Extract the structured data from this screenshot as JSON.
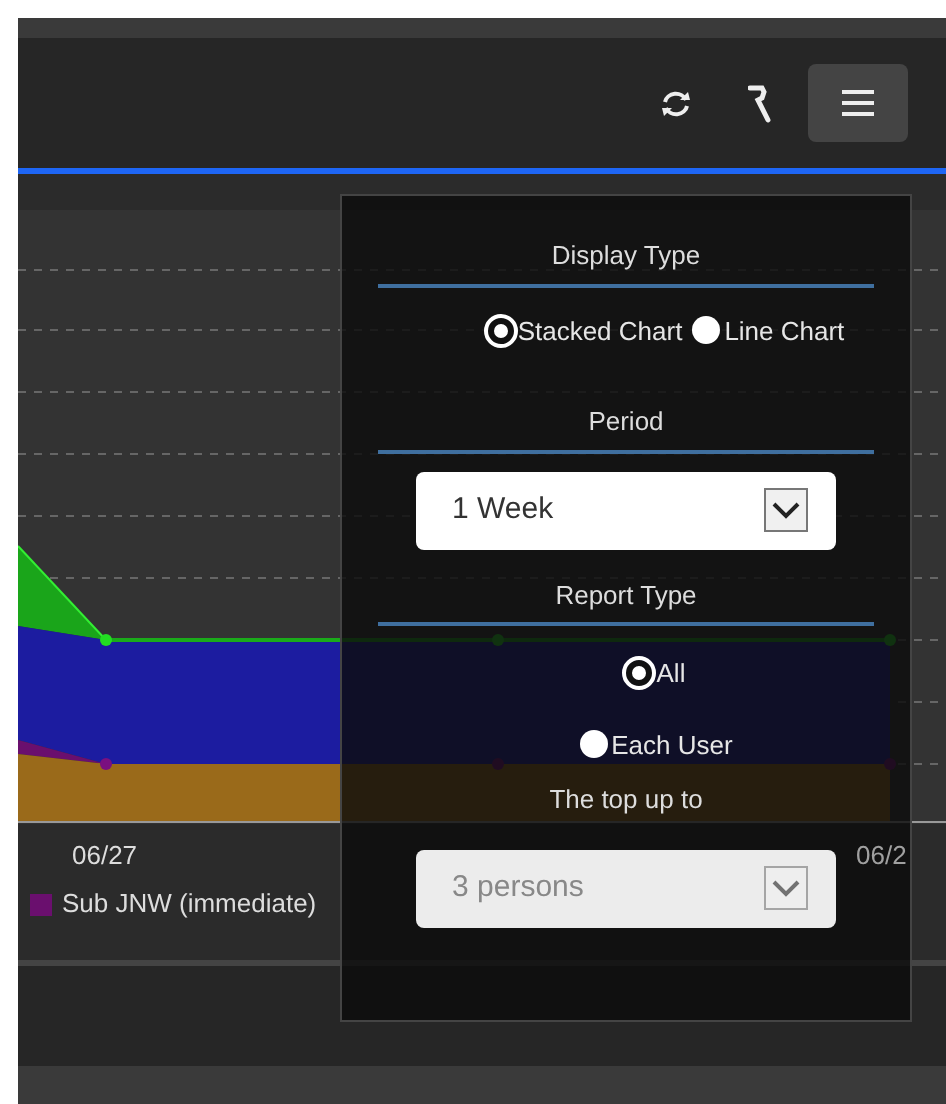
{
  "toolbar": {
    "menu_button": {
      "expanded": true
    }
  },
  "chart": {
    "x_labels": [
      "06/27",
      "06/2"
    ],
    "legend": [
      {
        "label": "Sub JNW (immediate)",
        "color": "#6a0f6e"
      }
    ]
  },
  "menu": {
    "sections": [
      {
        "kind": "radio_row",
        "title": "Display Type",
        "underlined": true,
        "options": [
          {
            "label": "Stacked Chart",
            "selected": true
          },
          {
            "label": "Line Chart",
            "selected": false
          }
        ]
      },
      {
        "kind": "select",
        "title": "Period",
        "underlined": true,
        "value": "1 Week",
        "disabled": false
      },
      {
        "kind": "radio_column",
        "title": "Report Type",
        "underlined": true,
        "options": [
          {
            "label": "All",
            "selected": true
          },
          {
            "label": "Each User",
            "selected": false
          }
        ]
      },
      {
        "kind": "select",
        "title": "The top up to",
        "value": "3 persons",
        "disabled": true,
        "underlined": false
      }
    ]
  }
}
